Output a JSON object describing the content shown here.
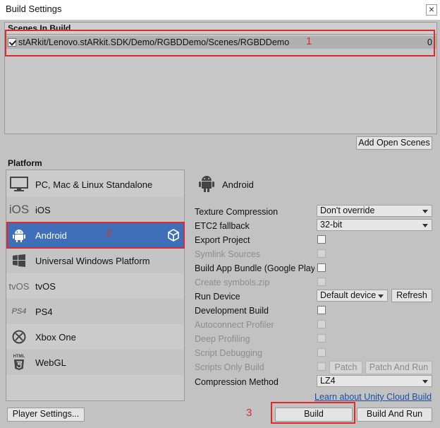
{
  "window": {
    "title": "Build Settings",
    "close_glyph": "×"
  },
  "scenes": {
    "header": "Scenes In Build",
    "items": [
      {
        "path": "stARkit/Lenovo.stARkit.SDK/Demo/RGBDDemo/Scenes/RGBDDemo",
        "index": "0",
        "checked": true
      }
    ],
    "add_open_scenes": "Add Open Scenes"
  },
  "platform": {
    "label": "Platform",
    "items": [
      {
        "label": "PC, Mac & Linux Standalone",
        "icon": "monitor-icon"
      },
      {
        "label": "iOS",
        "icon": "ios-icon",
        "icon_text": "iOS"
      },
      {
        "label": "Android",
        "icon": "android-icon",
        "selected": true
      },
      {
        "label": "Universal Windows Platform",
        "icon": "windows-icon"
      },
      {
        "label": "tvOS",
        "icon": "tvos-icon",
        "icon_text": "tvOS"
      },
      {
        "label": "PS4",
        "icon": "ps4-icon",
        "icon_text": "PS4"
      },
      {
        "label": "Xbox One",
        "icon": "xbox-icon"
      },
      {
        "label": "WebGL",
        "icon": "html5-icon",
        "icon_text": "HTML"
      }
    ]
  },
  "settings": {
    "title": "Android",
    "texture_compression": {
      "label": "Texture Compression",
      "value": "Don't override"
    },
    "etc2_fallback": {
      "label": "ETC2 fallback",
      "value": "32-bit"
    },
    "export_project": "Export Project",
    "symlink_sources": "Symlink Sources",
    "build_app_bundle": "Build App Bundle (Google Play)",
    "create_symbols_zip": "Create symbols.zip",
    "run_device": {
      "label": "Run Device",
      "value": "Default device",
      "refresh": "Refresh"
    },
    "development_build": "Development Build",
    "autoconnect_profiler": "Autoconnect Profiler",
    "deep_profiling": "Deep Profiling",
    "script_debugging": "Script Debugging",
    "scripts_only_build": {
      "label": "Scripts Only Build",
      "patch": "Patch",
      "patch_and_run": "Patch And Run"
    },
    "compression_method": {
      "label": "Compression Method",
      "value": "LZ4"
    }
  },
  "footer": {
    "cloud_build_link": "Learn about Unity Cloud Build",
    "player_settings": "Player Settings...",
    "build": "Build",
    "build_and_run": "Build And Run"
  },
  "annotations": [
    "1",
    "2",
    "3"
  ],
  "colors": {
    "selection": "#3e6fb8",
    "annotation": "#e02a2a",
    "link": "#1a4fa0"
  }
}
